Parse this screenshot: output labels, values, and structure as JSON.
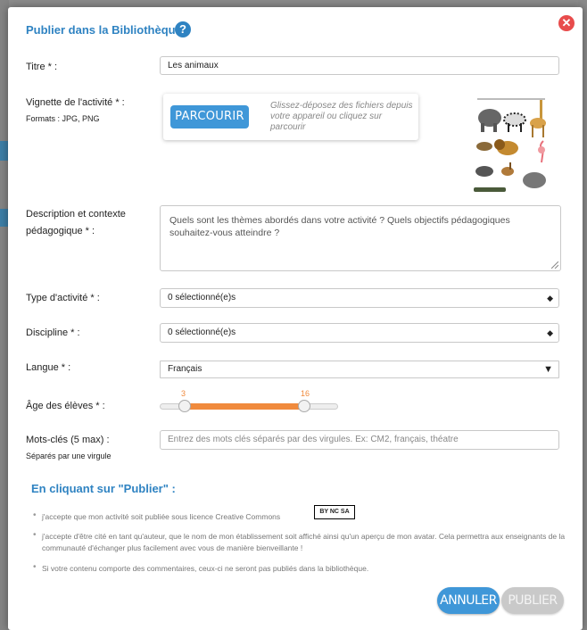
{
  "modal": {
    "title": "Publier dans la Bibliothèque",
    "help_icon": "?",
    "close_icon": "✕"
  },
  "fields": {
    "title": {
      "label": "Titre * :",
      "value": "Les animaux"
    },
    "thumbnail": {
      "label": "Vignette de l'activité * :",
      "sublabel": "Formats : JPG, PNG",
      "browse_label": "PARCOURIR",
      "drop_hint": "Glissez-déposez des fichiers depuis votre appareil ou cliquez sur parcourir"
    },
    "description": {
      "label_line1": "Description et contexte",
      "label_line2": "pédagogique * :",
      "placeholder": "Quels sont les thèmes abordés dans votre activité ? Quels objectifs pédagogiques souhaitez-vous atteindre ?"
    },
    "activity_type": {
      "label": "Type d'activité * :",
      "value": "0 sélectionné(e)s"
    },
    "discipline": {
      "label": "Discipline * :",
      "value": "0 sélectionné(e)s"
    },
    "language": {
      "label": "Langue * :",
      "value": "Français"
    },
    "age": {
      "label": "Âge des élèves * :",
      "min": "3",
      "max": "16",
      "min_fraction": 0.15,
      "max_fraction": 0.81
    },
    "keywords": {
      "label": "Mots-clés (5 max) :",
      "sublabel": "Séparés par une virgule",
      "placeholder": "Entrez des mots clés séparés par des virgules. Ex: CM2, français, théatre"
    }
  },
  "terms": {
    "heading": "En cliquant sur \"Publier\" :",
    "items": [
      "j'accepte que mon activité soit publiée sous licence Creative Commons",
      "j'accepte d'être cité en tant qu'auteur, que le nom de mon établissement soit affiché ainsi qu'un aperçu de mon avatar. Cela permettra aux enseignants de la communauté d'échanger plus facilement avec vous de manière bienveillante !",
      "Si votre contenu comporte des commentaires, ceux-ci ne seront pas publiés dans la bibliothèque."
    ],
    "cc_badge": "BY NC SA"
  },
  "buttons": {
    "cancel": "ANNULER",
    "publish": "PUBLIER"
  },
  "colors": {
    "accent": "#2f83c2",
    "button_blue": "#3f97d8",
    "slider": "#f08a3c",
    "close": "#e84c4c"
  }
}
